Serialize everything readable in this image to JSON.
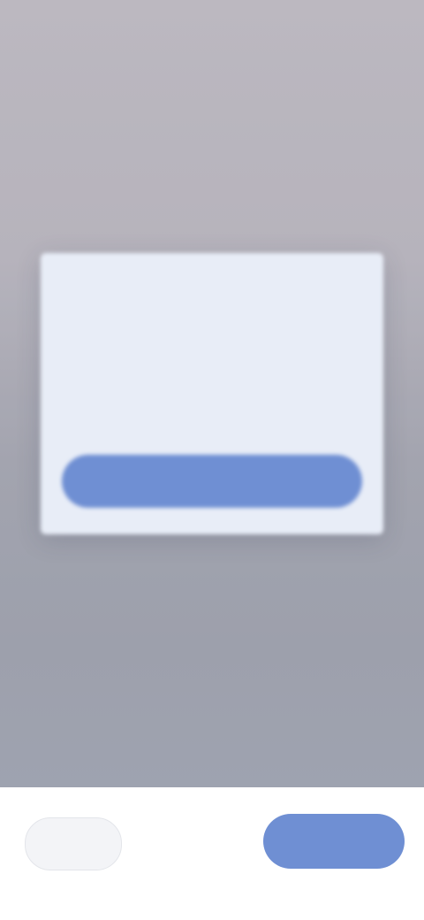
{
  "status_bar": {
    "time": "",
    "icons": ""
  },
  "header": {
    "title": "",
    "subtitle": ""
  },
  "section": {
    "label": ""
  },
  "tabs": [
    {
      "label": ""
    },
    {
      "label": ""
    },
    {
      "label": ""
    }
  ],
  "dialog": {
    "title": "",
    "body": "",
    "button_label": ""
  },
  "footer": {
    "back_label": "",
    "next_label": ""
  },
  "colors": {
    "accent": "#6f8fd3",
    "dialog_title": "#4b67b1",
    "dialog_background": "#e8edf7",
    "bottom_bar": "#ffffff"
  }
}
